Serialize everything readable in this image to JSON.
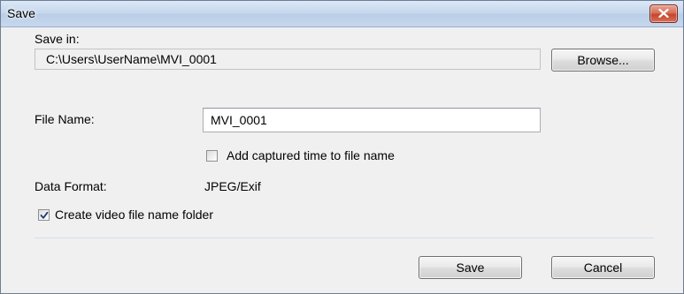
{
  "window": {
    "title": "Save"
  },
  "save_in": {
    "label": "Save in:",
    "path": "C:\\Users\\UserName\\MVI_0001",
    "browse_label": "Browse..."
  },
  "file_name": {
    "label": "File Name:",
    "value": "MVI_0001"
  },
  "add_time_option": {
    "label": "Add captured time to file name",
    "checked": false
  },
  "data_format": {
    "label": "Data Format:",
    "value": "JPEG/Exif"
  },
  "video_folder_option": {
    "label": "Create video file name folder",
    "checked": true
  },
  "actions": {
    "save_label": "Save",
    "cancel_label": "Cancel"
  },
  "icons": {
    "close": "close-icon",
    "check": "check-icon"
  }
}
